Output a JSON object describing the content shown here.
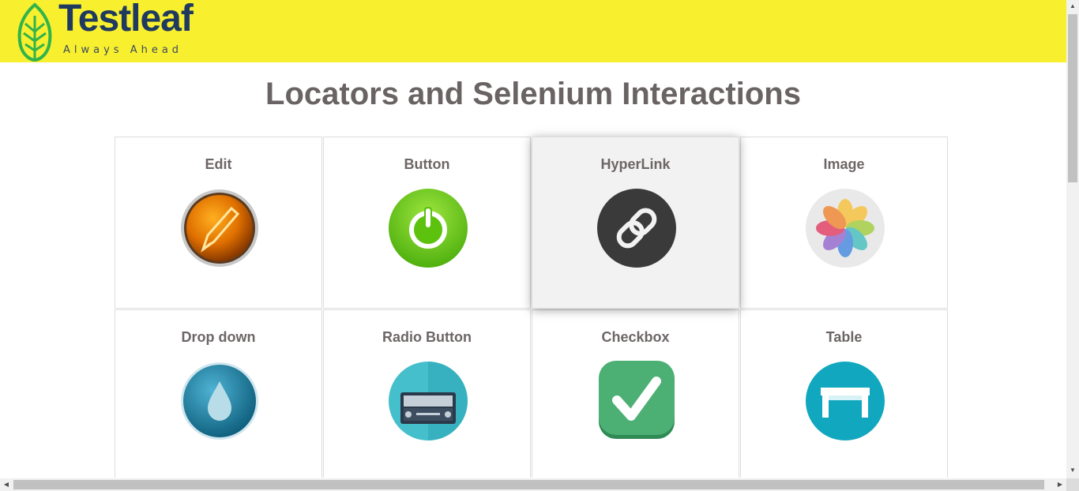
{
  "header": {
    "logo_name": "Testleaf",
    "logo_tagline": "Always Ahead",
    "background_color": "#f8ef2f"
  },
  "main": {
    "title": "Locators and Selenium Interactions",
    "cards": [
      {
        "label": "Edit",
        "icon": "pencil-edit-icon",
        "hovered": false
      },
      {
        "label": "Button",
        "icon": "power-button-icon",
        "hovered": false
      },
      {
        "label": "HyperLink",
        "icon": "chain-link-icon",
        "hovered": true
      },
      {
        "label": "Image",
        "icon": "photos-flower-icon",
        "hovered": false
      },
      {
        "label": "Drop down",
        "icon": "water-drop-icon",
        "hovered": false
      },
      {
        "label": "Radio Button",
        "icon": "radio-device-icon",
        "hovered": false
      },
      {
        "label": "Checkbox",
        "icon": "checkmark-icon",
        "hovered": false
      },
      {
        "label": "Table",
        "icon": "table-icon",
        "hovered": false
      }
    ]
  }
}
